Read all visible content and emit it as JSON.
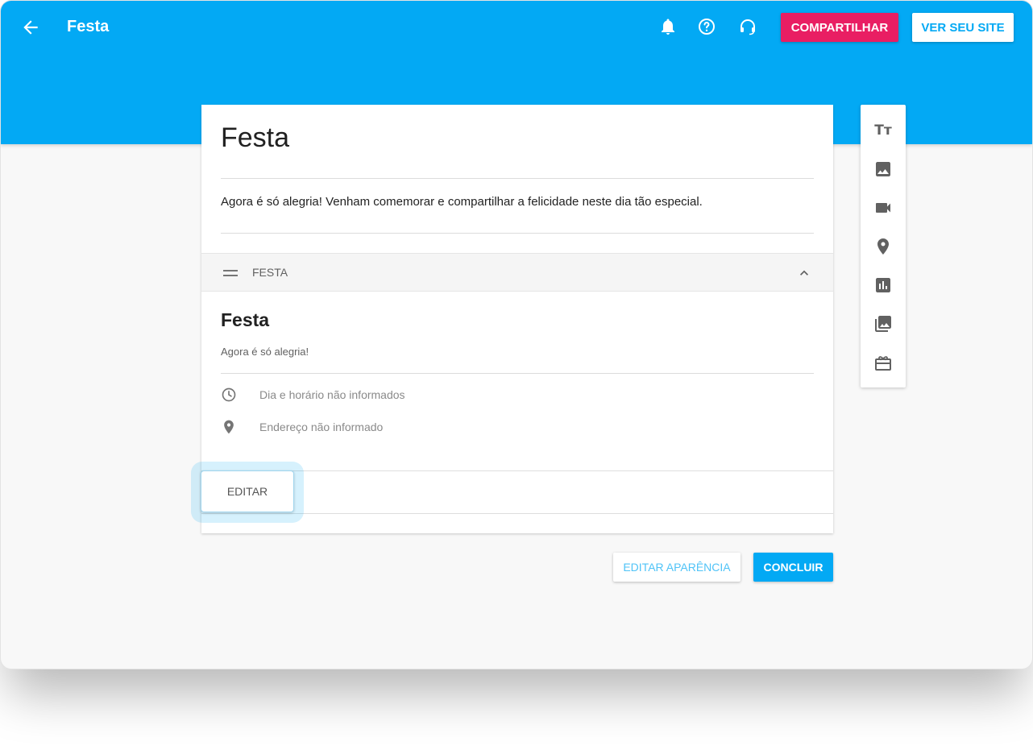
{
  "header": {
    "title": "Festa",
    "share_label": "COMPARTILHAR",
    "site_label": "VER SEU SITE"
  },
  "icons": {
    "back": "arrow-left-icon",
    "notifications": "bell-icon",
    "help": "help-circle-icon",
    "support": "headset-icon"
  },
  "page": {
    "title": "Festa",
    "description": "Agora é só alegria! Venham comemorar e compartilhar a felicidade neste dia tão especial."
  },
  "section": {
    "label": "FESTA",
    "event_title": "Festa",
    "event_subtitle": "Agora é só alegria!",
    "datetime": "Dia e horário não informados",
    "address": "Endereço não informado",
    "edit_label": "EDITAR"
  },
  "footer": {
    "appearance_label": "EDITAR APARÊNCIA",
    "conclude_label": "CONCLUIR"
  },
  "toolbox": {
    "text_glyph": "Tт",
    "items": [
      "text-icon",
      "image-icon",
      "video-icon",
      "location-icon",
      "chart-icon",
      "gallery-icon",
      "gift-icon"
    ]
  },
  "colors": {
    "primary": "#03a9f4",
    "accent": "#e91e63"
  }
}
